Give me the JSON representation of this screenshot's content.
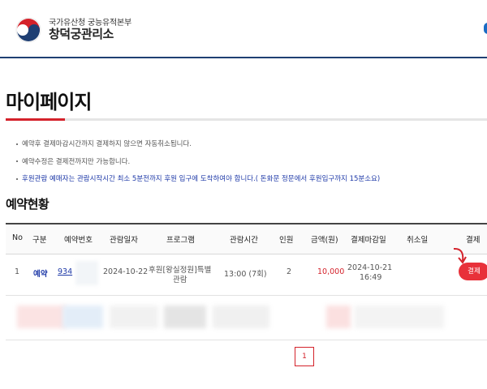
{
  "header": {
    "org_line": "국가유산청 궁능유적본부",
    "site_name": "창덕궁관리소"
  },
  "page": {
    "title": "마이페이지"
  },
  "notices": [
    "예약후 결제마감시간까지 결제하지 않으면 자동취소됩니다.",
    "예약수정은 결제전까지만 가능합니다.",
    "후원관람 예매자는 관람시작시간 최소 5분전까지 후원 입구에 도착하여야 합니다.( 돈화문 정문에서 후원입구까지 15분소요)"
  ],
  "reservations": {
    "title": "예약현황",
    "columns": [
      "No",
      "구분",
      "예약번호",
      "관람일자",
      "프로그램",
      "관람시간",
      "인원",
      "금액(원)",
      "결제마감일",
      "취소일",
      "결제"
    ],
    "rows": [
      {
        "no": "1",
        "type": "예약",
        "reservation_no": "934",
        "visit_date": "2024-10-22",
        "program_line1": "후원[왕실정원]특별",
        "program_line2": "관람",
        "visit_time": "13:00 (7회)",
        "people": "2",
        "amount": "10,000",
        "pay_deadline_date": "2024-10-21",
        "pay_deadline_time": "16:49",
        "cancel_date": "",
        "pay_label": "결제"
      }
    ]
  },
  "pagination": {
    "current": "1"
  },
  "colors": {
    "accent_red": "#d4222b",
    "navy": "#1f3f73",
    "link_blue": "#1f3aa8"
  }
}
